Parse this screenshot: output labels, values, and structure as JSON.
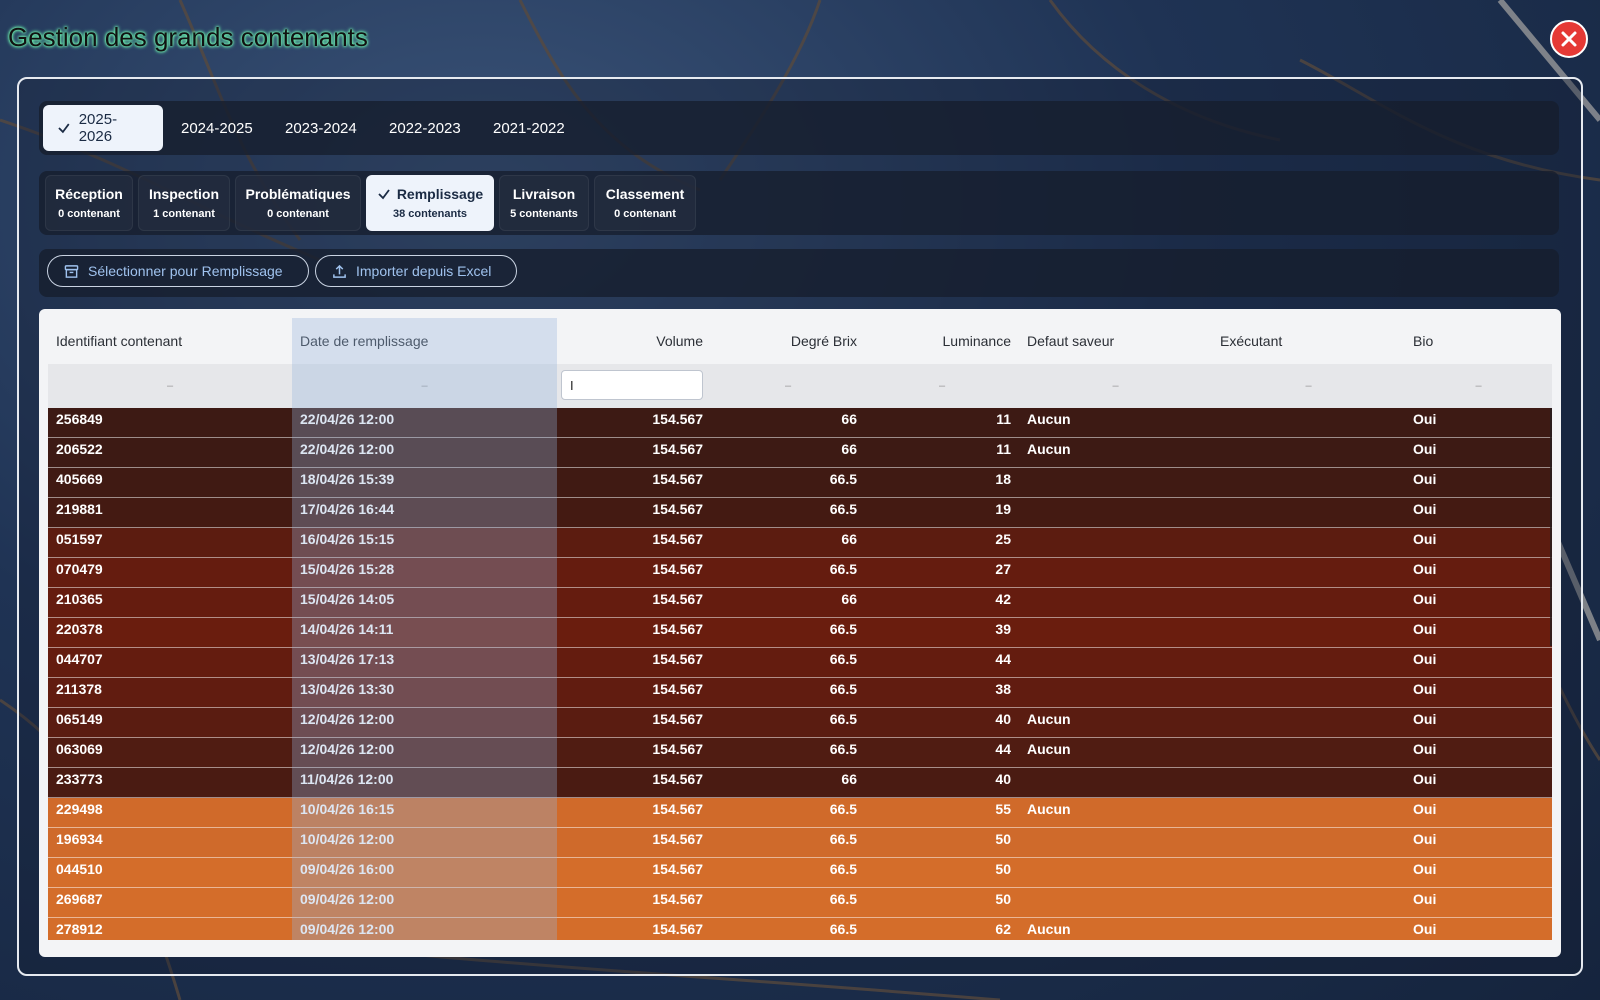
{
  "app": {
    "title": "Gestion des grands contenants"
  },
  "year_tabs": [
    {
      "label": "2025-2026",
      "active": true
    },
    {
      "label": "2024-2025",
      "active": false
    },
    {
      "label": "2023-2024",
      "active": false
    },
    {
      "label": "2022-2023",
      "active": false
    },
    {
      "label": "2021-2022",
      "active": false
    }
  ],
  "step_tabs": [
    {
      "label": "Réception",
      "count": "0 contenant",
      "active": false
    },
    {
      "label": "Inspection",
      "count": "1 contenant",
      "active": false
    },
    {
      "label": "Problématiques",
      "count": "0 contenant",
      "active": false
    },
    {
      "label": "Remplissage",
      "count": "38 contenants",
      "active": true
    },
    {
      "label": "Livraison",
      "count": "5 contenants",
      "active": false
    },
    {
      "label": "Classement",
      "count": "0 contenant",
      "active": false
    }
  ],
  "actions": {
    "select_label": "Sélectionner pour Remplissage",
    "import_label": "Importer depuis Excel"
  },
  "grid": {
    "columns": [
      "Identifiant contenant",
      "Date de remplissage",
      "Volume",
      "Degré Brix",
      "Luminance",
      "Defaut saveur",
      "Exécutant",
      "Bio"
    ],
    "filter_placeholder": "–",
    "filter_value": "I",
    "rows": [
      [
        "256849",
        "22/04/26 12:00",
        "154.567",
        "66",
        "11",
        "Aucun",
        "",
        "Oui"
      ],
      [
        "206522",
        "22/04/26 12:00",
        "154.567",
        "66",
        "11",
        "Aucun",
        "",
        "Oui"
      ],
      [
        "405669",
        "18/04/26 15:39",
        "154.567",
        "66.5",
        "18",
        "",
        "",
        "Oui"
      ],
      [
        "219881",
        "17/04/26 16:44",
        "154.567",
        "66.5",
        "19",
        "",
        "",
        "Oui"
      ],
      [
        "051597",
        "16/04/26 15:15",
        "154.567",
        "66",
        "25",
        "",
        "",
        "Oui"
      ],
      [
        "070479",
        "15/04/26 15:28",
        "154.567",
        "66.5",
        "27",
        "",
        "",
        "Oui"
      ],
      [
        "210365",
        "15/04/26 14:05",
        "154.567",
        "66",
        "42",
        "",
        "",
        "Oui"
      ],
      [
        "220378",
        "14/04/26 14:11",
        "154.567",
        "66.5",
        "39",
        "",
        "",
        "Oui"
      ],
      [
        "044707",
        "13/04/26 17:13",
        "154.567",
        "66.5",
        "44",
        "",
        "",
        "Oui"
      ],
      [
        "211378",
        "13/04/26 13:30",
        "154.567",
        "66.5",
        "38",
        "",
        "",
        "Oui"
      ],
      [
        "065149",
        "12/04/26 12:00",
        "154.567",
        "66.5",
        "40",
        "Aucun",
        "",
        "Oui"
      ],
      [
        "063069",
        "12/04/26 12:00",
        "154.567",
        "66.5",
        "44",
        "Aucun",
        "",
        "Oui"
      ],
      [
        "233773",
        "11/04/26 12:00",
        "154.567",
        "66",
        "40",
        "",
        "",
        "Oui"
      ],
      [
        "229498",
        "10/04/26 16:15",
        "154.567",
        "66.5",
        "55",
        "Aucun",
        "",
        "Oui"
      ],
      [
        "196934",
        "10/04/26 12:00",
        "154.567",
        "66.5",
        "50",
        "",
        "",
        "Oui"
      ],
      [
        "044510",
        "09/04/26 16:00",
        "154.567",
        "66.5",
        "50",
        "",
        "",
        "Oui"
      ],
      [
        "269687",
        "09/04/26 12:00",
        "154.567",
        "66.5",
        "50",
        "",
        "",
        "Oui"
      ],
      [
        "278912",
        "09/04/26 12:00",
        "154.567",
        "66.5",
        "62",
        "Aucun",
        "",
        "Oui"
      ]
    ],
    "row_colors": [
      "#3d1a14",
      "#3d1a14",
      "#401a13",
      "#441a12",
      "#5c1c10",
      "#651c0f",
      "#651c0f",
      "#6a1d0e",
      "#641c0f",
      "#611c10",
      "#5a1c11",
      "#501c12",
      "#4a1b12",
      "#d06a2a",
      "#cf6a2b",
      "#d46d2a",
      "#d46d2a",
      "#d46d2a"
    ]
  },
  "colors": {
    "close_button": "#e53935",
    "active_tab_bg": "#eef3fb",
    "action_text": "#9fc2ee"
  }
}
